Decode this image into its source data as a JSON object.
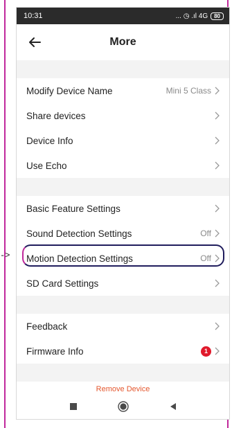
{
  "status_bar": {
    "time": "10:31",
    "signal": "... ◷ .ıl 4G",
    "battery": "80"
  },
  "header": {
    "title": "More",
    "back_icon": "arrow-left-icon"
  },
  "groups": [
    [
      {
        "label": "Modify Device Name",
        "value": "Mini 5 Class"
      },
      {
        "label": "Share devices",
        "value": ""
      },
      {
        "label": "Device Info",
        "value": ""
      },
      {
        "label": "Use Echo",
        "value": ""
      }
    ],
    [
      {
        "label": "Basic Feature Settings",
        "value": ""
      },
      {
        "label": "Sound Detection Settings",
        "value": "Off"
      },
      {
        "label": "Motion Detection Settings",
        "value": "Off"
      },
      {
        "label": "SD Card Settings",
        "value": ""
      }
    ],
    [
      {
        "label": "Feedback",
        "value": ""
      },
      {
        "label": "Firmware Info",
        "value": "",
        "badge": "1"
      }
    ]
  ],
  "annotation": {
    "arrow_text": "->",
    "highlight_color": "#1f1c5c",
    "frame_color": "#c0279b"
  },
  "footer": {
    "remove_label": "Remove Device",
    "accent_color": "#e4572e"
  },
  "softkeys": [
    "square-icon",
    "circle-icon",
    "triangle-left-icon"
  ]
}
